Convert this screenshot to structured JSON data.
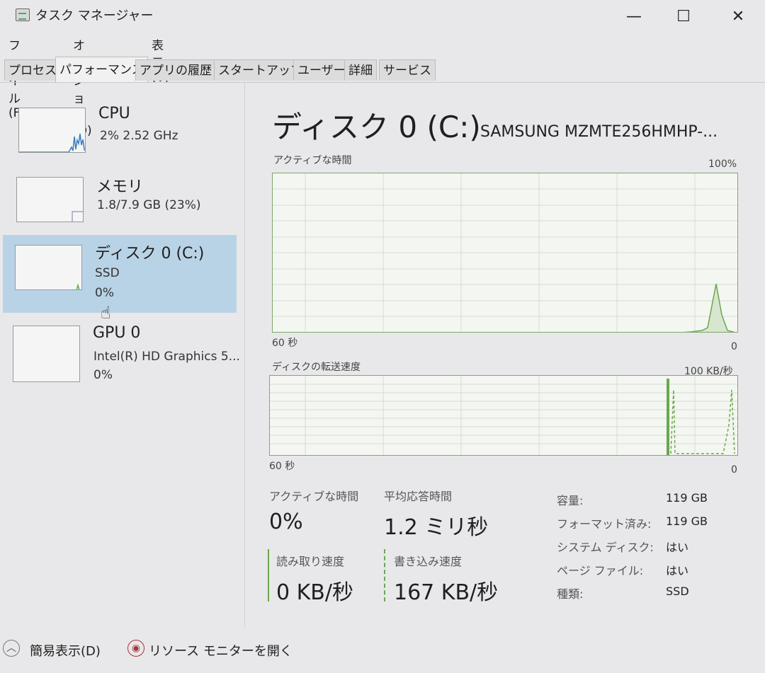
{
  "window": {
    "title": "タスク マネージャー",
    "minimize_label": "—",
    "maximize_label": "☐",
    "close_label": "✕"
  },
  "menu": [
    "ファイル(F)",
    "オプション(O)",
    "表示(V)"
  ],
  "tabs": [
    "プロセス",
    "パフォーマンス",
    "アプリの履歴",
    "スタートアップ",
    "ユーザー",
    "詳細",
    "サービス"
  ],
  "active_tab": "パフォーマンス",
  "sidebar": {
    "items": [
      {
        "name": "CPU",
        "line1": "2%  2.52 GHz",
        "line2": ""
      },
      {
        "name": "メモリ",
        "line1": "1.8/7.9 GB (23%)",
        "line2": ""
      },
      {
        "name": "ディスク 0 (C:)",
        "line1": "SSD",
        "line2": "0%"
      },
      {
        "name": "GPU 0",
        "line1": "Intel(R) HD Graphics 5...",
        "line2": "0%"
      }
    ],
    "selected_index": 2
  },
  "main": {
    "title": "ディスク 0 (C:)",
    "model": "SAMSUNG MZMTE256HMHP-...",
    "graph1": {
      "label": "アクティブな時間",
      "max_label": "100%",
      "time_label": "60 秒",
      "min_label": "0"
    },
    "graph2": {
      "label": "ディスクの転送速度",
      "max_label": "100 KB/秒",
      "time_label": "60 秒",
      "min_label": "0"
    },
    "stats": {
      "active_time_label": "アクティブな時間",
      "active_time_value": "0%",
      "response_label": "平均応答時間",
      "response_value": "1.2 ミリ秒",
      "read_label": "読み取り速度",
      "read_value": "0 KB/秒",
      "write_label": "書き込み速度",
      "write_value": "167 KB/秒"
    },
    "properties": [
      {
        "label": "容量:",
        "value": "119 GB"
      },
      {
        "label": "フォーマット済み:",
        "value": "119 GB"
      },
      {
        "label": "システム ディスク:",
        "value": "はい"
      },
      {
        "label": "ページ ファイル:",
        "value": "はい"
      },
      {
        "label": "種類:",
        "value": "SSD"
      }
    ]
  },
  "footer": {
    "fewer_details": "簡易表示(D)",
    "resource_monitor": "リソース モニターを開く"
  },
  "colors": {
    "graph_line": "#6aa84f",
    "selected_bg": "#b9d3e6",
    "cpu_line": "#3a7fc1"
  }
}
